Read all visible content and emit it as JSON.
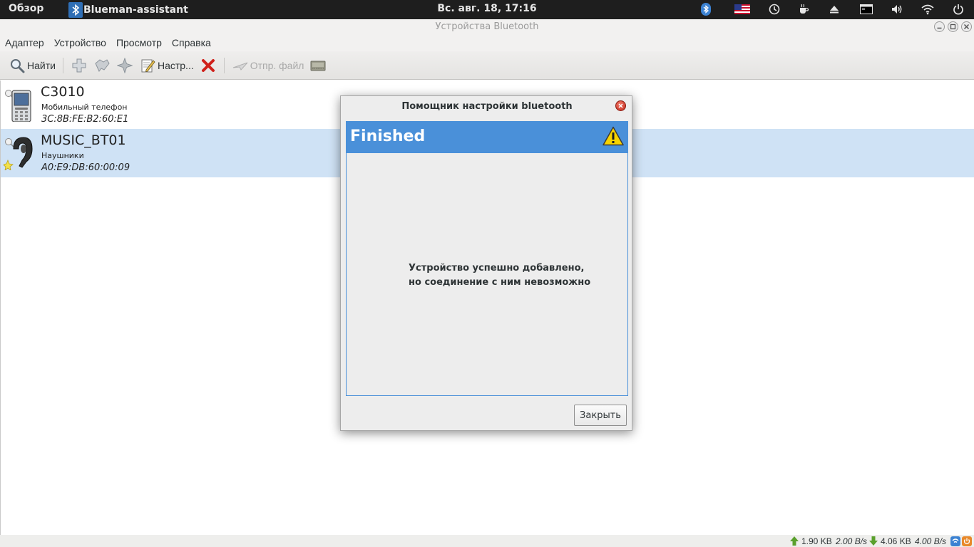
{
  "top_panel": {
    "activities": "Обзор",
    "app_name": "Blueman-assistant",
    "clock": "Вс. авг. 18, 17:16",
    "tray_icons": [
      "bluetooth-icon",
      "keyboard-layout-flag-icon",
      "clock-icon",
      "coffee-cup-icon",
      "eject-icon",
      "terminal-icon",
      "volume-icon",
      "wifi-icon",
      "power-icon"
    ]
  },
  "window": {
    "title": "Устройства Bluetooth"
  },
  "menubar": {
    "items": [
      "Адаптер",
      "Устройство",
      "Просмотр",
      "Справка"
    ]
  },
  "toolbar": {
    "search_label": "Найти",
    "setup_label": "Настр...",
    "send_file_label": "Отпр. файл"
  },
  "devices": [
    {
      "name": "C3010",
      "type": "Мобильный телефон",
      "address": "3C:8B:FE:B2:60:E1"
    },
    {
      "name": "MUSIC_BT01",
      "type": "Наушники",
      "address": "A0:E9:DB:60:00:09"
    }
  ],
  "statusbar": {
    "upload_total": "1.90 KB",
    "upload_rate": "2.00 B/s",
    "download_total": "4.06 KB",
    "download_rate": "4.00 B/s"
  },
  "dialog": {
    "title": "Помощник настройки bluetooth",
    "heading": "Finished",
    "message_line1": "Устройство успешно добавлено,",
    "message_line2": "но соединение с ним невозможно",
    "close_button": "Закрыть"
  },
  "colors": {
    "accent": "#4a90d9",
    "selection": "#cfe2f5",
    "panel": "#1e1e1e"
  }
}
